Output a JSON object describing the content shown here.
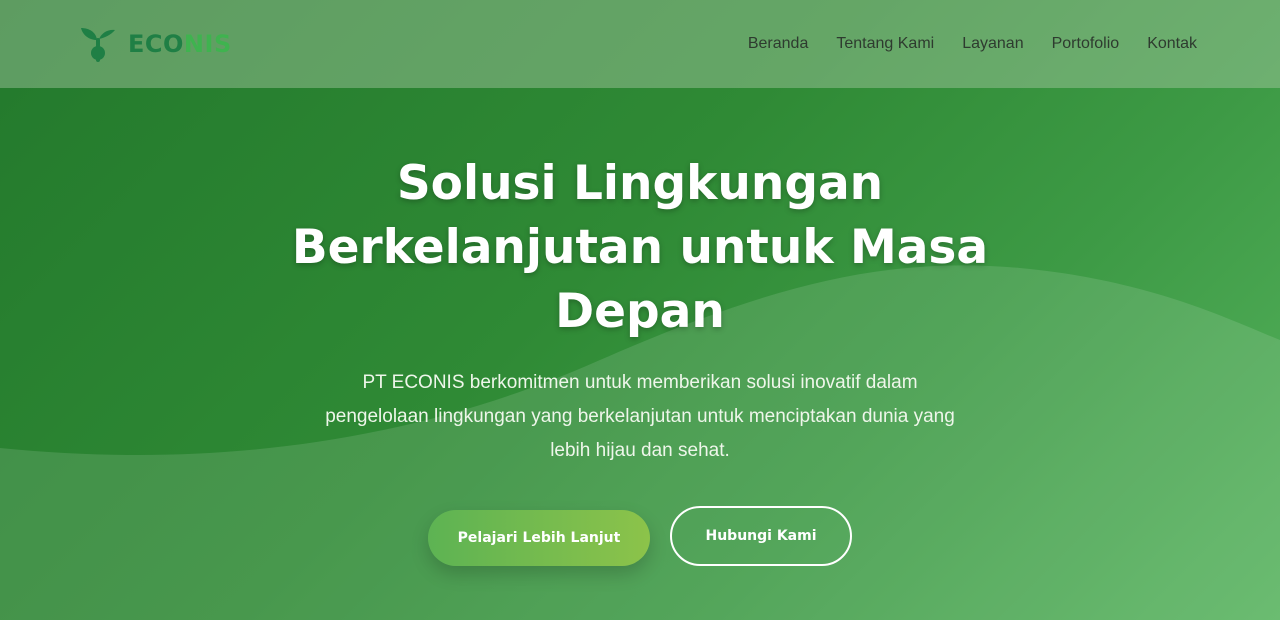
{
  "brand": {
    "name_part1": "ECO",
    "name_part2": "NIS",
    "icon": "sprout-icon"
  },
  "nav": {
    "items": [
      {
        "label": "Beranda"
      },
      {
        "label": "Tentang Kami"
      },
      {
        "label": "Layanan"
      },
      {
        "label": "Portofolio"
      },
      {
        "label": "Kontak"
      }
    ]
  },
  "hero": {
    "title_line1": "Solusi Lingkungan",
    "title_line2": "Berkelanjutan untuk Masa",
    "title_line3": "Depan",
    "description_line1": "PT ECONIS berkomitmen untuk memberikan solusi inovatif dalam",
    "description_line2": "pengelolaan lingkungan yang berkelanjutan untuk menciptakan dunia yang",
    "description_line3": "lebih hijau dan sehat.",
    "primary_button": "Pelajari Lebih Lanjut",
    "secondary_button": "Hubungi Kami"
  },
  "colors": {
    "brand_dark": "#1f7f45",
    "brand_light": "#3fb34f",
    "hero_green": "#2f8a35",
    "button_gradient_start": "#5db353",
    "button_gradient_end": "#8cc34a"
  }
}
